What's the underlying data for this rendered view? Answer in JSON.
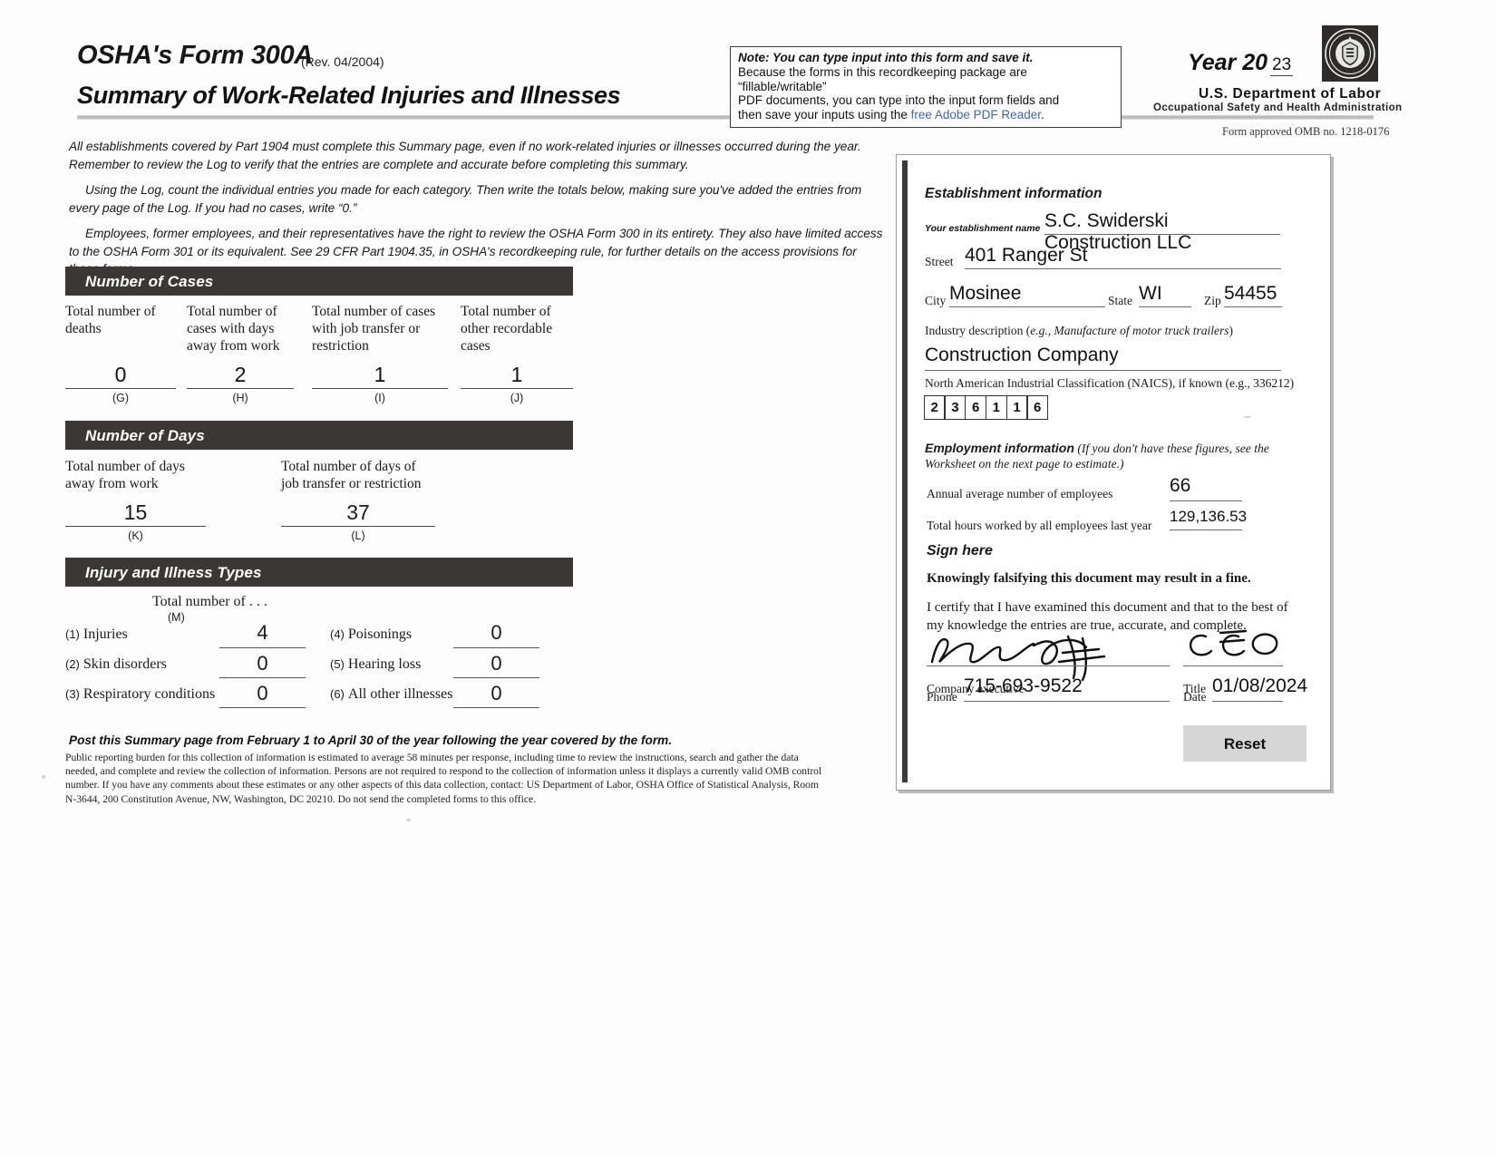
{
  "header": {
    "form_title": "OSHA's Form 300A",
    "revision": "(Rev. 04/2004)",
    "subtitle": "Summary of Work-Related Injuries and Illnesses",
    "note_bold": "Note: You can type input into this form and save it.",
    "note_line2": "Because the forms in this recordkeeping package are “fillable/writable”",
    "note_line3": "PDF documents, you can type into the input form fields and",
    "note_line4_pre": "then save your inputs using the ",
    "note_link": "free Adobe PDF Reader",
    "note_line4_post": ".",
    "year_label": "Year 20",
    "year_value": "23",
    "department": "U.S. Department of  Labor",
    "agency": "Occupational Safety and Health  Administration",
    "omb": "Form approved OMB no. 1218-0176",
    "seal_icon": "dol-seal-icon"
  },
  "intro": {
    "p1": "All establishments covered by Part 1904 must complete this Summary page, even if no work-related injuries or illnesses occurred during the year. Remember to review the Log to verify that the entries are complete and accurate before completing this summary.",
    "p2": "Using the Log, count the individual entries you made for each category. Then write the totals below, making sure you've added the entries from every page of the Log. If you had no cases, write “0.”",
    "p3": "Employees, former employees, and their representatives have the right to review the OSHA Form 300 in its entirety. They also have limited access to the OSHA Form 301 or its equivalent. See 29 CFR Part 1904.35, in OSHA's recordkeeping rule, for further details on the access provisions for these forms."
  },
  "number_of_cases": {
    "section_title": "Number of Cases",
    "columns": [
      {
        "label": "Total number of deaths",
        "value": "0",
        "code": "(G)"
      },
      {
        "label": "Total number of cases  with  days away from work",
        "value": "2",
        "code": "(H)"
      },
      {
        "label": "Total number of cases with job transfer or restriction",
        "value": "1",
        "code": "(I)"
      },
      {
        "label": "Total number of other recordable cases",
        "value": "1",
        "code": "(J)"
      }
    ]
  },
  "number_of_days": {
    "section_title": "Number of Days",
    "columns": [
      {
        "label": "Total number of days away from work",
        "value": "15",
        "code": "(K)"
      },
      {
        "label": "Total number of days of job transfer or restriction",
        "value": "37",
        "code": "(L)"
      }
    ]
  },
  "injury_illness_types": {
    "section_title": "Injury and Illness Types",
    "total_label": "Total number of . . .",
    "total_code": "(M)",
    "left_items": [
      {
        "num": "(1)",
        "name": "Injuries",
        "value": "4"
      },
      {
        "num": "(2)",
        "name": "Skin disorders",
        "value": "0"
      },
      {
        "num": "(3)",
        "name": "Respiratory conditions",
        "value": "0"
      }
    ],
    "right_items": [
      {
        "num": "(4)",
        "name": "Poisonings",
        "value": "0"
      },
      {
        "num": "(5)",
        "name": "Hearing loss",
        "value": "0"
      },
      {
        "num": "(6)",
        "name": "All other illnesses",
        "value": "0"
      }
    ]
  },
  "footer": {
    "post_note": "Post this Summary page from February 1 to April 30 of the year following the year covered by the form.",
    "burden": "Public reporting burden for this collection of information is estimated to average 58 minutes per response, including time to review the instructions, search and gather the data needed, and complete and review the collection of information. Persons are not required to respond to the collection of information unless it displays a currently valid OMB control number. If you have any comments about these estimates or any other aspects of this data collection, contact: US Department of Labor, OSHA Office of Statistical Analysis, Room N-3644, 200 Constitution Avenue, NW, Washington, DC 20210. Do not send the completed forms to this office."
  },
  "establishment": {
    "heading": "Establishment information",
    "name_label": "Your establishment name",
    "name_value": "S.C. Swiderski Construction LLC",
    "street_label": "Street",
    "street_value": "401 Ranger St",
    "city_label": "City",
    "city_value": "Mosinee",
    "state_label": "State",
    "state_value": "WI",
    "zip_label": "Zip",
    "zip_value": "54455",
    "industry_label_pre": "Industry description (",
    "industry_label_ital": "e.g., Manufacture of motor truck trailers",
    "industry_label_post": ")",
    "industry_value": "Construction Company",
    "naics_label": "North American Industrial Classification (NAICS), if known (e.g., 336212)",
    "naics_digits": [
      "2",
      "3",
      "6",
      "1",
      "1",
      "6"
    ]
  },
  "employment": {
    "heading_bold": "Employment information",
    "heading_ital": "(If you don't have these figures, see the Worksheet on the next page to estimate.)",
    "employees_label": "Annual average number of employees",
    "employees_value": "66",
    "hours_label": "Total hours worked by all employees last year",
    "hours_value": "129,136.53"
  },
  "sign": {
    "sign_here": "Sign here",
    "falsify": "Knowingly falsifying this document may result in a fine.",
    "certify": "I certify that I have examined this document and that to the best of my knowledge the entries are true, accurate, and complete.",
    "signature_icon": "signature-scribble-icon",
    "executive_label": "Company executive",
    "title_label": "Title",
    "title_value": "CEO",
    "phone_label": "Phone",
    "phone_value": "715-693-9522",
    "date_label": "Date",
    "date_value": "01/08/2024"
  },
  "actions": {
    "reset_label": "Reset"
  }
}
